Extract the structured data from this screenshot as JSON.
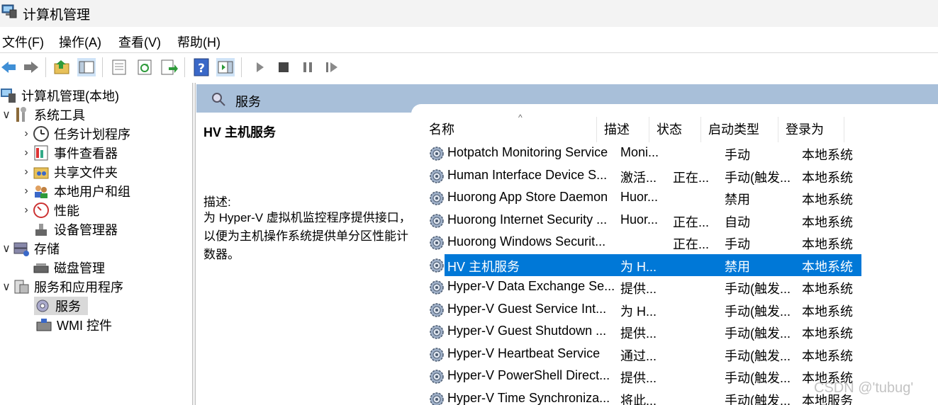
{
  "window": {
    "title": "计算机管理"
  },
  "menu": [
    "文件(F)",
    "操作(A)",
    "查看(V)",
    "帮助(H)"
  ],
  "toolbar_icons": [
    "back-arrow-icon",
    "forward-arrow-icon",
    "up-folder-icon",
    "show-hide-tree-icon",
    "properties-icon",
    "refresh-icon",
    "export-list-icon",
    "help-icon",
    "show-action-pane-icon",
    "start-service-icon",
    "stop-service-icon",
    "pause-service-icon",
    "resume-service-icon"
  ],
  "tree": {
    "root": "计算机管理(本地)",
    "system_tools": "系统工具",
    "task_scheduler": "任务计划程序",
    "event_viewer": "事件查看器",
    "shared_folders": "共享文件夹",
    "local_users": "本地用户和组",
    "performance": "性能",
    "device_manager": "设备管理器",
    "storage": "存储",
    "disk_management": "磁盘管理",
    "services_apps": "服务和应用程序",
    "services": "服务",
    "wmi": "WMI 控件"
  },
  "pane": {
    "header": "服务",
    "selected_service": "HV 主机服务",
    "description_label": "描述:",
    "description_text": "为 Hyper-V 虚拟机监控程序提供接口，以便为主机操作系统提供单分区性能计数器。"
  },
  "columns": {
    "name": "名称",
    "desc": "描述",
    "status": "状态",
    "startup": "启动类型",
    "logon": "登录为",
    "sort_indicator": "^"
  },
  "services": [
    {
      "name": "Hotpatch Monitoring Service",
      "desc": "Moni...",
      "status": "",
      "startup": "手动",
      "logon": "本地系统"
    },
    {
      "name": "Human Interface Device S...",
      "desc": "激活...",
      "status": "正在...",
      "startup": "手动(触发...",
      "logon": "本地系统"
    },
    {
      "name": "Huorong App Store Daemon",
      "desc": "Huor...",
      "status": "",
      "startup": "禁用",
      "logon": "本地系统"
    },
    {
      "name": "Huorong Internet Security ...",
      "desc": "Huor...",
      "status": "正在...",
      "startup": "自动",
      "logon": "本地系统"
    },
    {
      "name": "Huorong Windows Securit...",
      "desc": "",
      "status": "正在...",
      "startup": "手动",
      "logon": "本地系统"
    },
    {
      "name": "HV 主机服务",
      "desc": "为 H...",
      "status": "",
      "startup": "禁用",
      "logon": "本地系统"
    },
    {
      "name": "Hyper-V Data Exchange Se...",
      "desc": "提供...",
      "status": "",
      "startup": "手动(触发...",
      "logon": "本地系统"
    },
    {
      "name": "Hyper-V Guest Service Int...",
      "desc": "为 H...",
      "status": "",
      "startup": "手动(触发...",
      "logon": "本地系统"
    },
    {
      "name": "Hyper-V Guest Shutdown ...",
      "desc": "提供...",
      "status": "",
      "startup": "手动(触发...",
      "logon": "本地系统"
    },
    {
      "name": "Hyper-V Heartbeat Service",
      "desc": "通过...",
      "status": "",
      "startup": "手动(触发...",
      "logon": "本地系统"
    },
    {
      "name": "Hyper-V PowerShell Direct...",
      "desc": "提供...",
      "status": "",
      "startup": "手动(触发...",
      "logon": "本地系统"
    },
    {
      "name": "Hyper-V Time Synchroniza...",
      "desc": "将此...",
      "status": "",
      "startup": "手动(触发...",
      "logon": "本地服务"
    }
  ],
  "selected_index": 5,
  "watermark": "CSDN @'tubug'",
  "colors": {
    "selection": "#0078d7",
    "header_band": "#a8bfd9"
  }
}
